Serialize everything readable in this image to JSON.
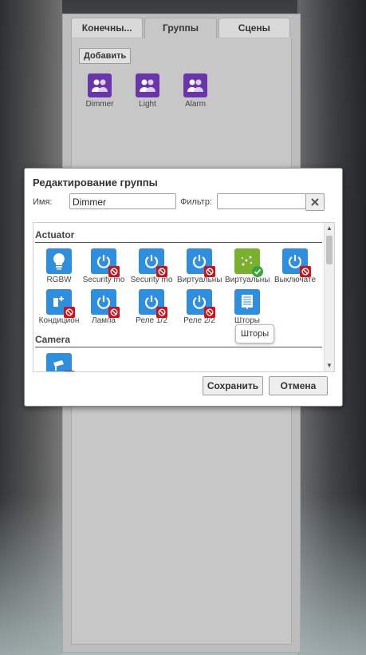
{
  "tabs": [
    {
      "label": "Конечны..."
    },
    {
      "label": "Группы"
    },
    {
      "label": "Сцены"
    }
  ],
  "add_button": "Добавить",
  "groups": [
    {
      "label": "Dimmer",
      "icon": "group-users-icon"
    },
    {
      "label": "Light",
      "icon": "group-users-icon"
    },
    {
      "label": "Alarm",
      "icon": "group-users-icon"
    }
  ],
  "dialog": {
    "title": "Редактирование группы",
    "name_label": "Имя:",
    "name_value": "Dimmer",
    "filter_label": "Фильтр:",
    "filter_value": "",
    "sections": [
      {
        "title": "Actuator",
        "devices": [
          {
            "label": "RGBW",
            "icon": "bulb-icon",
            "status": "none"
          },
          {
            "label": "Security mo",
            "icon": "power-icon",
            "status": "blocked"
          },
          {
            "label": "Security mo",
            "icon": "power-icon",
            "status": "blocked"
          },
          {
            "label": "Виртуальны",
            "icon": "power-icon",
            "status": "blocked"
          },
          {
            "label": "Виртуальны",
            "icon": "sparkle-icon",
            "status": "checked"
          },
          {
            "label": "Выключате",
            "icon": "power-icon",
            "status": "blocked"
          },
          {
            "label": "Кондицион",
            "icon": "ac-icon",
            "status": "blocked"
          },
          {
            "label": "Лампа",
            "icon": "power-icon",
            "status": "blocked"
          },
          {
            "label": "Реле 1/2",
            "icon": "power-icon",
            "status": "blocked"
          },
          {
            "label": "Реле 2/2",
            "icon": "power-icon",
            "status": "blocked"
          },
          {
            "label": "Шторы",
            "icon": "blinds-icon",
            "status": "none"
          }
        ]
      },
      {
        "title": "Camera",
        "devices": [
          {
            "label": "",
            "icon": "camera-icon",
            "status": "blocked"
          }
        ]
      }
    ],
    "tooltip": "Шторы",
    "save_button": "Сохранить",
    "cancel_button": "Отмена"
  },
  "colors": {
    "device_blue": "#2f8ede",
    "device_green": "#79b12e",
    "group_purple": "#6a35a8",
    "blocked_red": "#c8151b"
  }
}
